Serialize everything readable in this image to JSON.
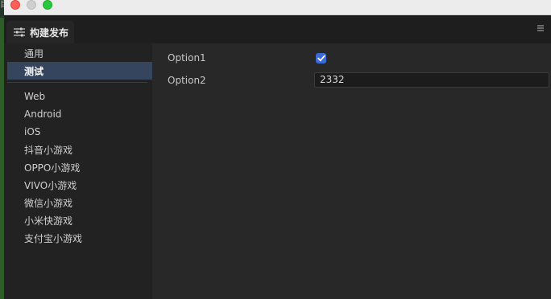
{
  "panel": {
    "title": "构建发布",
    "tab_icon": "sliders-icon",
    "menu_icon": "hamburger-menu-icon"
  },
  "sidebar": {
    "items": [
      {
        "label": "通用",
        "active": false
      },
      {
        "label": "测试",
        "active": true
      },
      {
        "label": "Web",
        "active": false
      },
      {
        "label": "Android",
        "active": false
      },
      {
        "label": "iOS",
        "active": false
      },
      {
        "label": "抖音小游戏",
        "active": false
      },
      {
        "label": "OPPO小游戏",
        "active": false
      },
      {
        "label": "VIVO小游戏",
        "active": false
      },
      {
        "label": "微信小游戏",
        "active": false
      },
      {
        "label": "小米快游戏",
        "active": false
      },
      {
        "label": "支付宝小游戏",
        "active": false
      }
    ]
  },
  "options": {
    "option1": {
      "label": "Option1",
      "checked": true
    },
    "option2": {
      "label": "Option2",
      "value": "2332"
    }
  },
  "colors": {
    "accent": "#3d6bd6",
    "active_item_bg": "#35455e",
    "close": "#fe5f57",
    "zoom": "#28c840"
  }
}
